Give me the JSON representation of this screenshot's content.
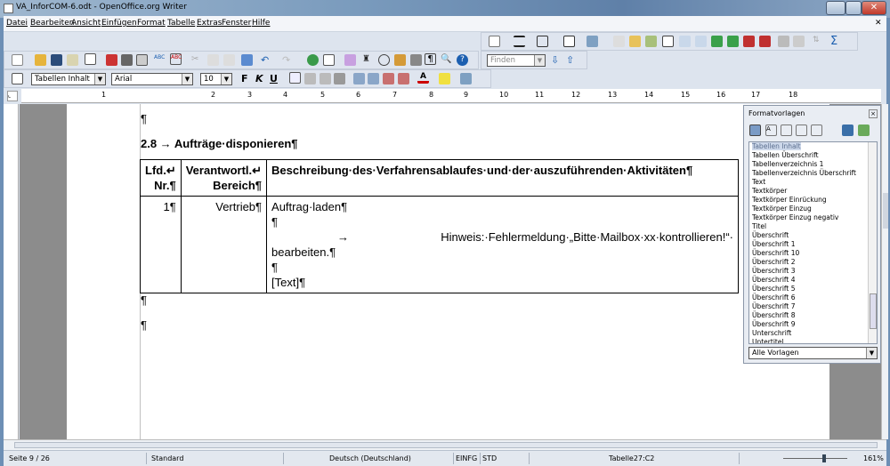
{
  "window": {
    "title": "VA_InforCOM-6.odt - OpenOffice.org Writer"
  },
  "menu": [
    "Datei",
    "Bearbeiten",
    "Ansicht",
    "Einfügen",
    "Format",
    "Tabelle",
    "Extras",
    "Fenster",
    "Hilfe"
  ],
  "formatting": {
    "paragraph_style": "Tabellen Inhalt",
    "font": "Arial",
    "size": "10",
    "bold": "F",
    "italic": "K",
    "underline": "U"
  },
  "find": {
    "placeholder": "Finden"
  },
  "ruler": [
    "1",
    "2",
    "3",
    "4",
    "5",
    "6",
    "7",
    "8",
    "9",
    "10",
    "11",
    "12",
    "13",
    "14",
    "15",
    "16",
    "17",
    "18"
  ],
  "document": {
    "para_mark": "¶",
    "heading": "2.8 → Aufträge·disponieren¶",
    "table": {
      "headers": [
        "Lfd.↵ Nr.¶",
        "Verantwortl.↵ Bereich¶",
        "Beschreibung·des·Verfahrensablaufes·und·der·auszuführenden·Aktivitäten¶"
      ],
      "row": {
        "nr": "1¶",
        "bereich": "Vertrieb¶",
        "lines": [
          "Auftrag·laden¶",
          "¶",
          "→",
          "Hinweis:·Fehlermeldung·„Bitte·Mailbox·xx·kontrollieren!“·",
          "bearbeiten.¶",
          "¶",
          "[Text]¶"
        ]
      }
    }
  },
  "stylist": {
    "title": "Formatvorlagen",
    "items": [
      "Tabellen Inhalt",
      "Tabellen Überschrift",
      "Tabellenverzeichnis 1",
      "Tabellenverzeichnis Überschrift",
      "Text",
      "Textkörper",
      "Textkörper Einrückung",
      "Textkörper Einzug",
      "Textkörper Einzug negativ",
      "Titel",
      "Überschrift",
      "Überschrift 1",
      "Überschrift 10",
      "Überschrift 2",
      "Überschrift 3",
      "Überschrift 4",
      "Überschrift 5",
      "Überschrift 6",
      "Überschrift 7",
      "Überschrift 8",
      "Überschrift 9",
      "Unterschrift",
      "Untertitel"
    ],
    "filter": "Alle Vorlagen"
  },
  "status": {
    "page": "Seite 9 / 26",
    "style": "Standard",
    "language": "Deutsch (Deutschland)",
    "insert": "EINFG",
    "selection": "STD",
    "cell": "Tabelle27:C2",
    "zoom": "161%"
  },
  "zoom_slider": {
    "percent": 161
  }
}
